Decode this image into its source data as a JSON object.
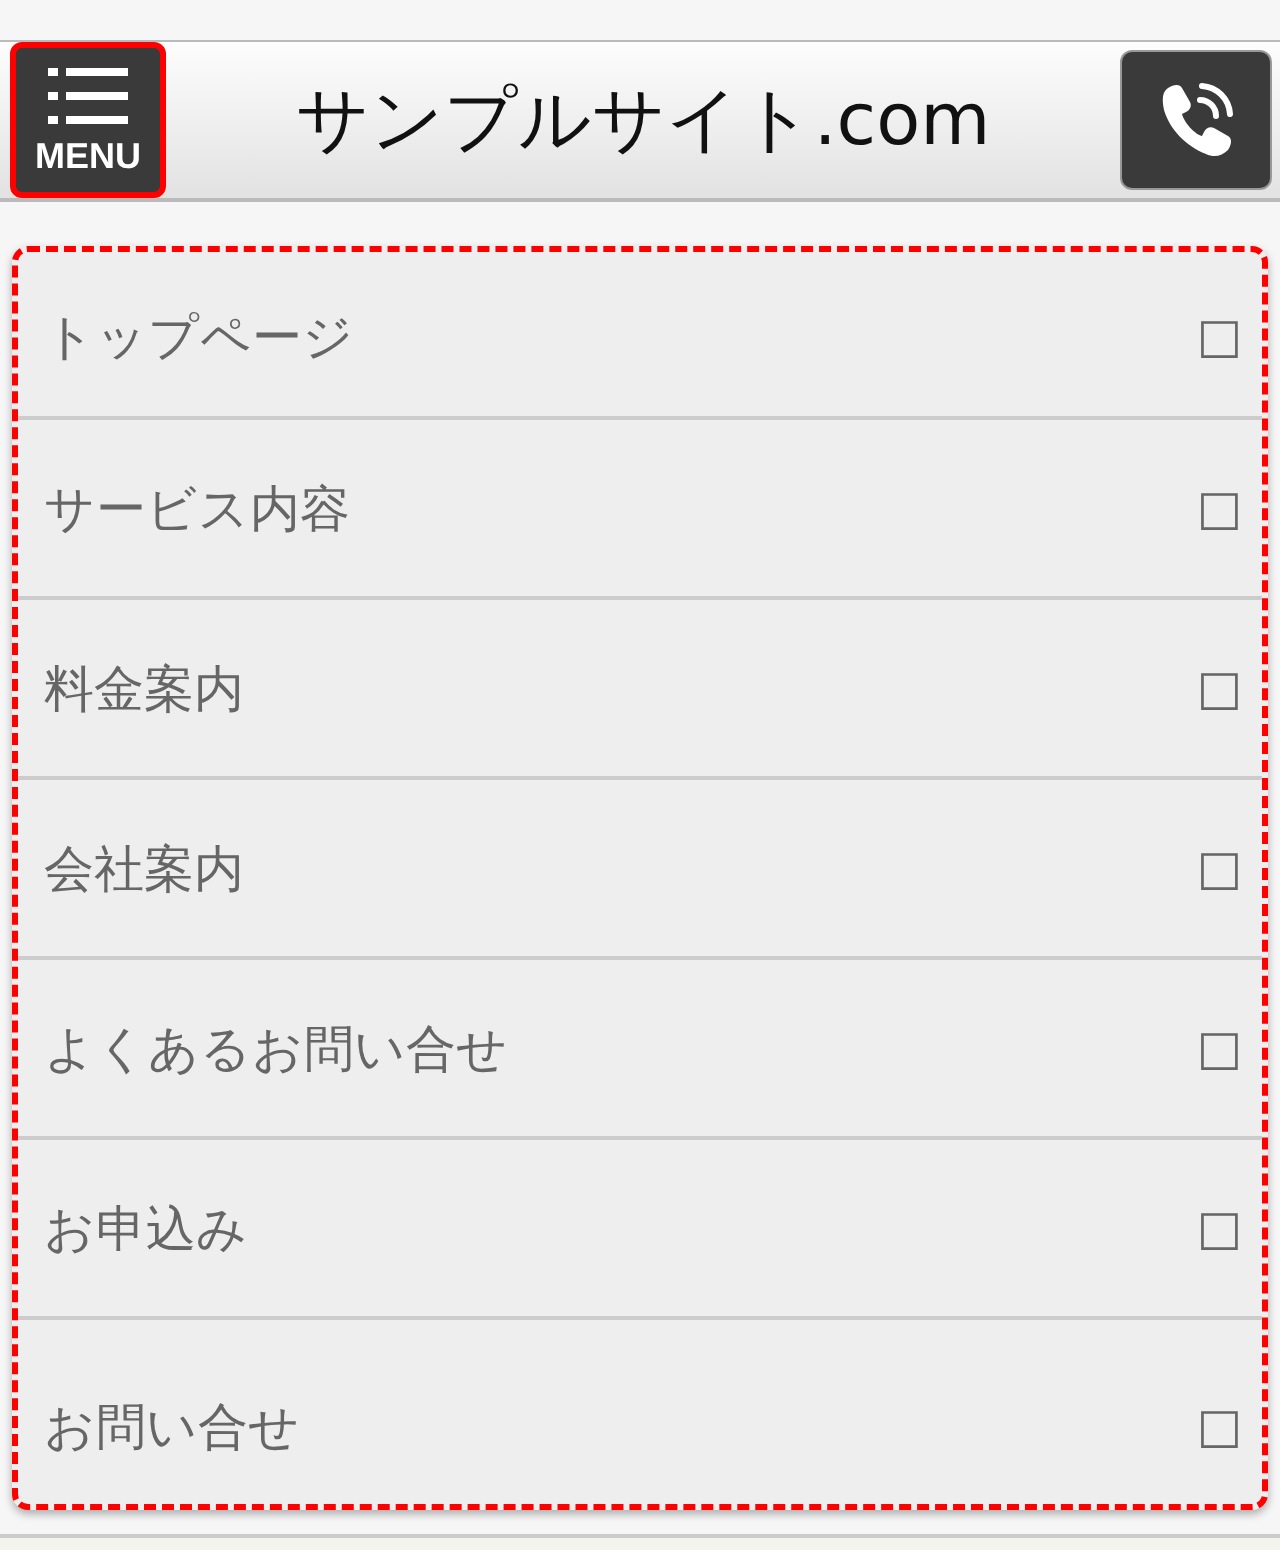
{
  "header": {
    "menu_label": "MENU",
    "title": "サンプルサイト.com"
  },
  "menu_items": [
    {
      "label": "トップページ",
      "mark": "□"
    },
    {
      "label": "サービス内容",
      "mark": "□"
    },
    {
      "label": "料金案内",
      "mark": "□"
    },
    {
      "label": "会社案内",
      "mark": "□"
    },
    {
      "label": "よくあるお問い合せ",
      "mark": "□"
    },
    {
      "label": "お申込み",
      "mark": "□"
    },
    {
      "label": "お問い合せ",
      "mark": "□"
    }
  ]
}
